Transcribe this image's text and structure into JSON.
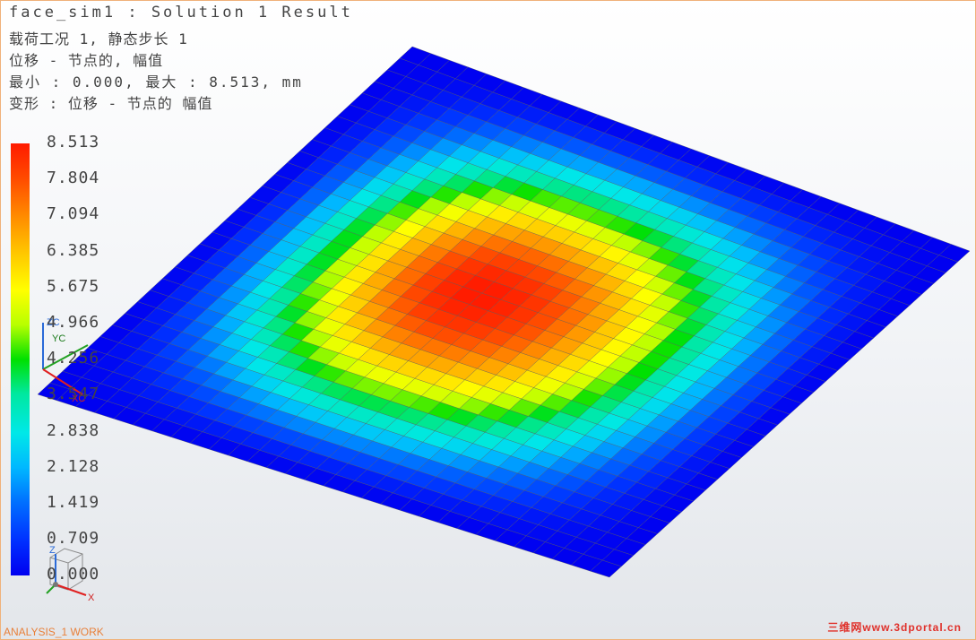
{
  "header": {
    "title": "face_sim1 : Solution 1 Result",
    "load_case": "载荷工况 1, 静态步长 1",
    "result_type": "位移 - 节点的, 幅值",
    "min_max": "最小 : 0.000, 最大 : 8.513, mm",
    "deformation": "变形 : 位移 - 节点的 幅值"
  },
  "legend": {
    "labels": [
      "8.513",
      "7.804",
      "7.094",
      "6.385",
      "5.675",
      "4.966",
      "4.256",
      "3.547",
      "2.838",
      "2.128",
      "1.419",
      "0.709",
      "0.000"
    ],
    "min": 0.0,
    "max": 8.513,
    "unit": "mm"
  },
  "plot": {
    "max_location_fraction": [
      0.43,
      0.53
    ],
    "colors": {
      "max": "#ff1a00",
      "min": "#0000f0",
      "mesh": "#5a5a5a"
    }
  },
  "triad": {
    "zc": "ZC",
    "yc": "YC",
    "xc": "XC"
  },
  "mini_triad": {
    "z": "Z",
    "x": "X"
  },
  "status_bar": {
    "text": "ANALYSIS_1 WORK"
  },
  "watermark": {
    "text": "三维网www.3dportal.cn"
  }
}
